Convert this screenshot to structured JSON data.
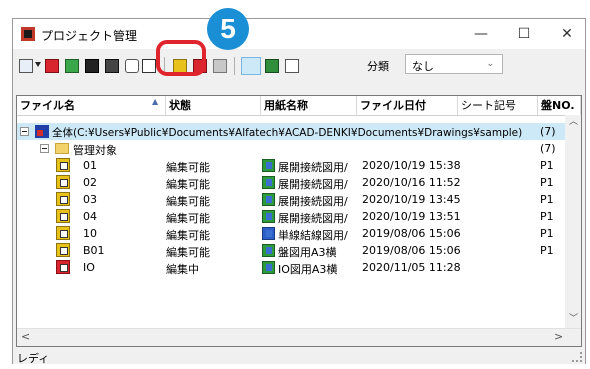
{
  "window": {
    "title": "プロジェクト管理",
    "minimize": "—",
    "maximize": "☐",
    "close": "✕"
  },
  "callout": {
    "number": "5"
  },
  "toolbar": {
    "bunrui_label": "分類",
    "bunrui_value": "なし"
  },
  "columns": [
    "ファイル名",
    "状態",
    "用紙名称",
    "ファイル日付",
    "シート記号",
    "盤NO."
  ],
  "root_path": "全体(C:¥Users¥Public¥Documents¥Alfatech¥ACAD-DENKI¥Documents¥Drawings¥sample)",
  "root_count": "(7)",
  "group": {
    "label": "管理対象",
    "count": "(7)"
  },
  "rows": [
    {
      "name": "01",
      "status": "編集可能",
      "paper": "展開接続図用/",
      "date": "2020/10/19 15:38",
      "sheet": "",
      "panel": "P1"
    },
    {
      "name": "02",
      "status": "編集可能",
      "paper": "展開接続図用/",
      "date": "2020/10/16 11:52",
      "sheet": "",
      "panel": "P1"
    },
    {
      "name": "03",
      "status": "編集可能",
      "paper": "展開接続図用/",
      "date": "2020/10/19 13:45",
      "sheet": "",
      "panel": "P1"
    },
    {
      "name": "04",
      "status": "編集可能",
      "paper": "展開接続図用/",
      "date": "2020/10/19 13:51",
      "sheet": "",
      "panel": "P1"
    },
    {
      "name": "10",
      "status": "編集可能",
      "paper": "単線結線図用/",
      "date": "2019/08/06 15:06",
      "sheet": "",
      "panel": "P1"
    },
    {
      "name": "B01",
      "status": "編集可能",
      "paper": "盤図用A3横",
      "date": "2019/08/06 15:06",
      "sheet": "",
      "panel": "P1"
    },
    {
      "name": "IO",
      "status": "編集中",
      "paper": "IO図用A3横",
      "date": "2020/11/05 11:28",
      "sheet": "",
      "panel": ""
    }
  ],
  "status_bar": "レディ",
  "colors": {
    "callout_blue": "#1a8fd6",
    "callout_red": "#e0242e",
    "selection": "#cde8f6"
  }
}
